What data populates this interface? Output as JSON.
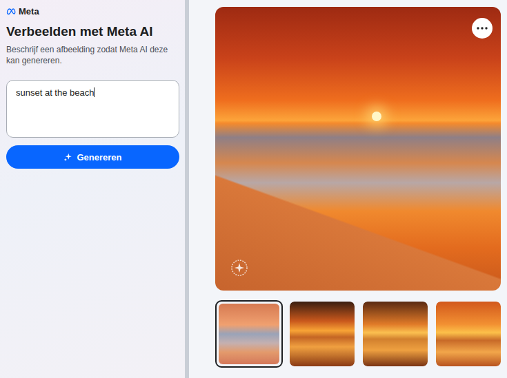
{
  "brand": {
    "name": "Meta"
  },
  "panel": {
    "title": "Verbeelden met Meta AI",
    "description": "Beschrijf een afbeelding zodat Meta AI deze kan genereren."
  },
  "prompt": {
    "value": "sunset at the beach"
  },
  "generate_button": {
    "label": "Genereren"
  },
  "thumbnails": [
    {
      "selected": true
    },
    {
      "selected": false
    },
    {
      "selected": false
    },
    {
      "selected": false
    }
  ]
}
